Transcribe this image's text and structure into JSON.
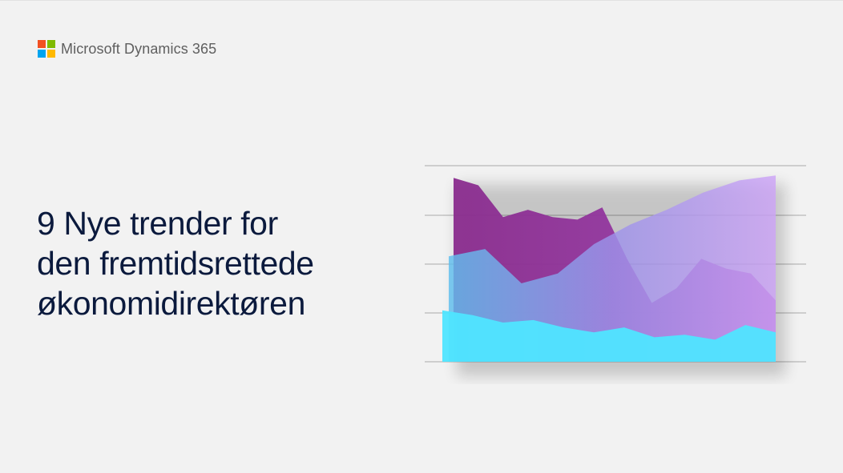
{
  "brand": {
    "name": "Microsoft Dynamics 365",
    "logo_colors": [
      "#f25022",
      "#7fba00",
      "#00a4ef",
      "#ffb900"
    ]
  },
  "title": {
    "line1": "9 Nye trender for",
    "line2": "den fremtidsrettede",
    "line3": "økonomidirektøren"
  },
  "illustration": {
    "type": "area",
    "colors": {
      "back": "#8a2c8e",
      "middle": "#b07ee6",
      "front": "#4fe5ff",
      "grid": "#a9a9a9"
    },
    "series": [
      {
        "values": [
          3.75,
          3.6,
          2.95,
          3.1,
          2.95,
          2.9,
          3.15,
          2.1,
          1.2,
          1.5,
          2.1,
          1.9,
          1.8,
          1.25
        ]
      },
      {
        "values": [
          2.15,
          2.3,
          1.6,
          1.8,
          2.4,
          2.8,
          3.1,
          3.45,
          3.7,
          3.8
        ]
      },
      {
        "values": [
          1.05,
          0.95,
          0.8,
          0.85,
          0.7,
          0.6,
          0.7,
          0.5,
          0.55,
          0.45,
          0.75,
          0.6
        ]
      }
    ]
  }
}
